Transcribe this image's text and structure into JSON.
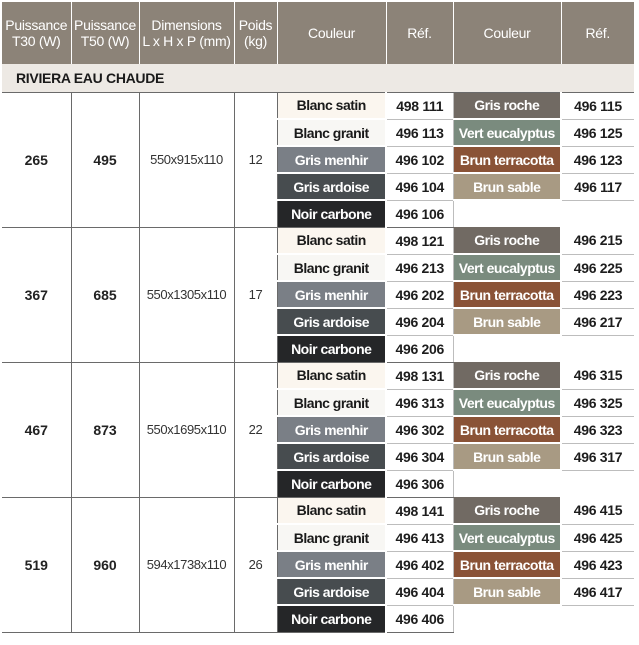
{
  "colors": {
    "Blanc satin": {
      "bg": "#fbf6ef",
      "fg": "#1a1a1a"
    },
    "Blanc granit": {
      "bg": "#f8f7f4",
      "fg": "#1a1a1a"
    },
    "Gris menhir": {
      "bg": "#7a7f86",
      "fg": "#ffffff"
    },
    "Gris ardoise": {
      "bg": "#474c4f",
      "fg": "#ffffff"
    },
    "Noir carbone": {
      "bg": "#252628",
      "fg": "#ffffff"
    },
    "Gris roche": {
      "bg": "#716a63",
      "fg": "#ffffff"
    },
    "Vert eucalyptus": {
      "bg": "#7a8b7e",
      "fg": "#ffffff"
    },
    "Brun terracotta": {
      "bg": "#8a5337",
      "fg": "#ffffff"
    },
    "Brun sable": {
      "bg": "#a89a83",
      "fg": "#ffffff"
    }
  },
  "headers": {
    "p30_l1": "Puissance",
    "p30_l2": "T30 (W)",
    "p50_l1": "Puissance",
    "p50_l2": "T50 (W)",
    "dim_l1": "Dimensions",
    "dim_l2": "L x H x P (mm)",
    "poids_l1": "Poids",
    "poids_l2": "(kg)",
    "couleur1": "Couleur",
    "ref1": "Réf.",
    "couleur2": "Couleur",
    "ref2": "Réf."
  },
  "section_title": "RIVIERA EAU CHAUDE",
  "groups": [
    {
      "p30": "265",
      "p50": "495",
      "dimensions": "550x915x110",
      "poids": "12",
      "rows": [
        {
          "c1": "Blanc satin",
          "r1": "498 111",
          "c2": "Gris roche",
          "r2": "496 115"
        },
        {
          "c1": "Blanc granit",
          "r1": "496 113",
          "c2": "Vert eucalyptus",
          "r2": "496 125"
        },
        {
          "c1": "Gris menhir",
          "r1": "496 102",
          "c2": "Brun terracotta",
          "r2": "496 123"
        },
        {
          "c1": "Gris ardoise",
          "r1": "496 104",
          "c2": "Brun sable",
          "r2": "496 117"
        },
        {
          "c1": "Noir carbone",
          "r1": "496 106",
          "c2": "",
          "r2": ""
        }
      ]
    },
    {
      "p30": "367",
      "p50": "685",
      "dimensions": "550x1305x110",
      "poids": "17",
      "rows": [
        {
          "c1": "Blanc satin",
          "r1": "498 121",
          "c2": "Gris roche",
          "r2": "496 215"
        },
        {
          "c1": "Blanc granit",
          "r1": "496 213",
          "c2": "Vert eucalyptus",
          "r2": "496 225"
        },
        {
          "c1": "Gris menhir",
          "r1": "496 202",
          "c2": "Brun terracotta",
          "r2": "496 223"
        },
        {
          "c1": "Gris ardoise",
          "r1": "496 204",
          "c2": "Brun sable",
          "r2": "496 217"
        },
        {
          "c1": "Noir carbone",
          "r1": "496 206",
          "c2": "",
          "r2": ""
        }
      ]
    },
    {
      "p30": "467",
      "p50": "873",
      "dimensions": "550x1695x110",
      "poids": "22",
      "rows": [
        {
          "c1": "Blanc satin",
          "r1": "498 131",
          "c2": "Gris roche",
          "r2": "496 315"
        },
        {
          "c1": "Blanc granit",
          "r1": "496 313",
          "c2": "Vert eucalyptus",
          "r2": "496 325"
        },
        {
          "c1": "Gris menhir",
          "r1": "496 302",
          "c2": "Brun terracotta",
          "r2": "496 323"
        },
        {
          "c1": "Gris ardoise",
          "r1": "496 304",
          "c2": "Brun sable",
          "r2": "496 317"
        },
        {
          "c1": "Noir carbone",
          "r1": "496 306",
          "c2": "",
          "r2": ""
        }
      ]
    },
    {
      "p30": "519",
      "p50": "960",
      "dimensions": "594x1738x110",
      "poids": "26",
      "rows": [
        {
          "c1": "Blanc satin",
          "r1": "498 141",
          "c2": "Gris roche",
          "r2": "496 415"
        },
        {
          "c1": "Blanc granit",
          "r1": "496 413",
          "c2": "Vert eucalyptus",
          "r2": "496 425"
        },
        {
          "c1": "Gris menhir",
          "r1": "496 402",
          "c2": "Brun terracotta",
          "r2": "496 423"
        },
        {
          "c1": "Gris ardoise",
          "r1": "496 404",
          "c2": "Brun sable",
          "r2": "496 417"
        },
        {
          "c1": "Noir carbone",
          "r1": "496 406",
          "c2": "",
          "r2": ""
        }
      ]
    }
  ]
}
